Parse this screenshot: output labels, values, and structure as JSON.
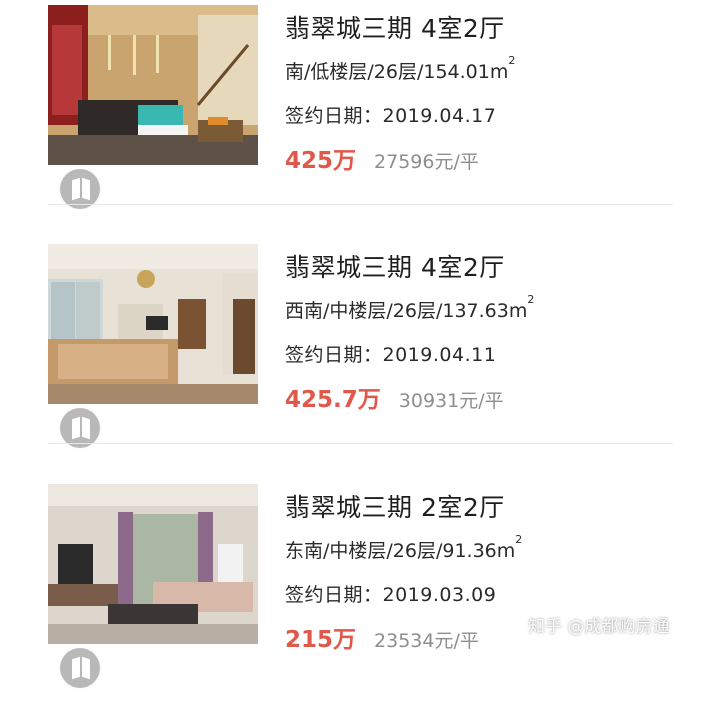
{
  "listings": [
    {
      "title": "翡翠城三期 4室2厅",
      "detail": "南/低楼层/26层/154.01m",
      "area_sup": "2",
      "sign_date": "签约日期：2019.04.17",
      "total_price": "425万",
      "unit_price": "27596元/平"
    },
    {
      "title": "翡翠城三期 4室2厅",
      "detail": "西南/中楼层/26层/137.63m",
      "area_sup": "2",
      "sign_date": "签约日期：2019.04.11",
      "total_price": "425.7万",
      "unit_price": "30931元/平"
    },
    {
      "title": "翡翠城三期 2室2厅",
      "detail": "东南/中楼层/26层/91.36m",
      "area_sup": "2",
      "sign_date": "签约日期：2019.03.09",
      "total_price": "215万",
      "unit_price": "23534元/平"
    }
  ],
  "watermark": "知乎 @成都购房通",
  "colors": {
    "price": "#e0584a",
    "unit_price": "#8e8e8e",
    "divider": "#e8e8e8"
  },
  "icons": [
    "vr-badge-icon"
  ]
}
